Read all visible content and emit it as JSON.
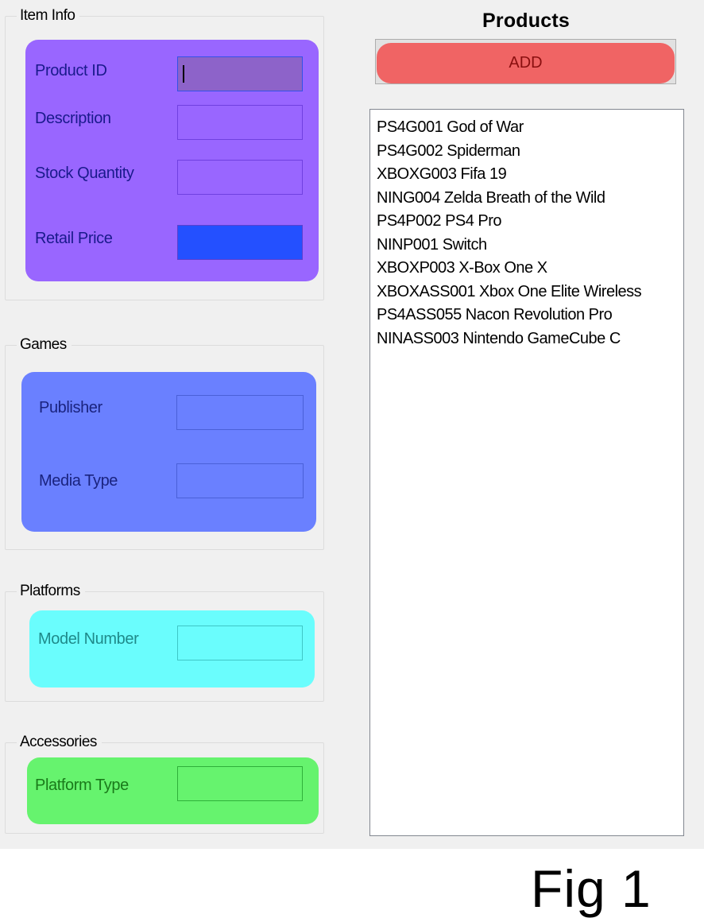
{
  "item_info": {
    "title": "Item Info",
    "fields": [
      {
        "label": "Product ID",
        "value": ""
      },
      {
        "label": "Description",
        "value": ""
      },
      {
        "label": "Stock Quantity",
        "value": ""
      },
      {
        "label": "Retail Price",
        "value": ""
      }
    ]
  },
  "games": {
    "title": "Games",
    "fields": [
      {
        "label": "Publisher",
        "value": ""
      },
      {
        "label": "Media Type",
        "value": ""
      }
    ]
  },
  "platforms": {
    "title": "Platforms",
    "fields": [
      {
        "label": "Model Number",
        "value": ""
      }
    ]
  },
  "accessories": {
    "title": "Accessories",
    "fields": [
      {
        "label": "Platform Type",
        "value": ""
      }
    ]
  },
  "products": {
    "title": "Products",
    "add_label": "ADD",
    "items": [
      "PS4G001 God of War",
      "PS4G002 Spiderman",
      "XBOXG003 Fifa 19",
      "NING004 Zelda Breath of the Wild",
      "PS4P002 PS4 Pro",
      "NINP001 Switch",
      "XBOXP003 X-Box One X",
      "XBOXASS001 Xbox One Elite Wireless",
      "PS4ASS055 Nacon Revolution Pro",
      "NINASS003 Nintendo GameCube C"
    ]
  },
  "caption": "Fig 1",
  "colors": {
    "form_bg": "#f0f0f0",
    "item_info_panel": "#9966ff",
    "games_panel": "#6a80ff",
    "platforms_panel": "#6afdfd",
    "accessories_panel": "#66f36e",
    "add_button": "#f06464",
    "add_button_text": "#8a0f0f"
  }
}
